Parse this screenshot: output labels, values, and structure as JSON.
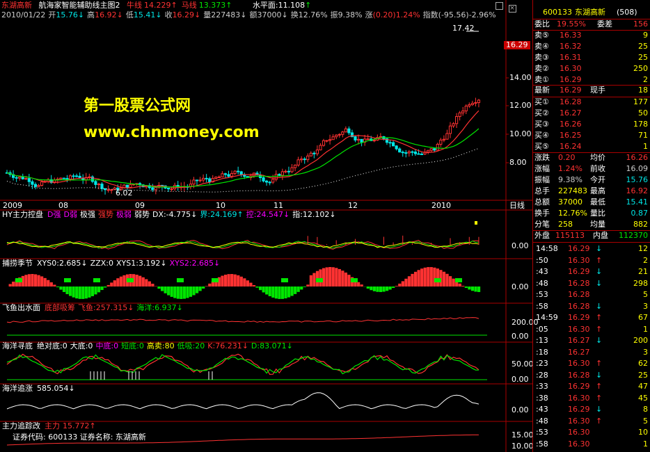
{
  "title": {
    "stock": "东湖高新",
    "formula": "航海家智能辅助线主图2",
    "lines": [
      {
        "k": "牛线",
        "v": "14.229",
        "dir": "↑"
      },
      {
        "k": "马线",
        "v": "13.373",
        "dir": "↑"
      }
    ],
    "water": "水平面:11.108",
    "water_dir": "↑"
  },
  "info_line": [
    {
      "k": "2010/01/22",
      "v": "",
      "c": "#cccccc"
    },
    {
      "k": "开",
      "v": "15.76",
      "c": "#00e6e6",
      "dir": "↓"
    },
    {
      "k": "高",
      "v": "16.92",
      "c": "#ff3232",
      "dir": "↓"
    },
    {
      "k": "低",
      "v": "15.41",
      "c": "#00e6e6",
      "dir": "↓"
    },
    {
      "k": "收",
      "v": "16.29",
      "c": "#ff3232",
      "dir": "↓"
    },
    {
      "k": "量",
      "v": "227483",
      "c": "#cccccc",
      "dir": "↓"
    },
    {
      "k": "额",
      "v": "37000",
      "c": "#cccccc",
      "dir": "↓"
    },
    {
      "k": "换",
      "v": "12.76%",
      "c": "#cccccc",
      "dir": ""
    },
    {
      "k": "振",
      "v": "9.38%",
      "c": "#cccccc",
      "dir": ""
    },
    {
      "k": "涨",
      "v": "(0.20)1.24%",
      "c": "#ff3232",
      "dir": ""
    },
    {
      "k": "指数",
      "v": "(-95.56)-2.96%",
      "c": "#cccccc",
      "dir": ""
    }
  ],
  "price_axis": [
    "14.00",
    "12.00",
    "10.00",
    "8.00"
  ],
  "current_price": "16.29",
  "peak_label": "17.42",
  "low_label": "6.02",
  "watermark": {
    "cn": "第一股票公式网",
    "url": "www.chnmoney.com"
  },
  "x_axis": [
    "2009",
    "08",
    "09",
    "10",
    "11",
    "12",
    "2010"
  ],
  "period": "日线",
  "panels": [
    {
      "id": "p1",
      "name": "HY主力控盘",
      "items": [
        {
          "t": "D强",
          "c": "#ff00ff"
        },
        {
          "t": "D弱",
          "c": "#ff00ff"
        },
        {
          "t": "极强",
          "c": "#ffffff"
        },
        {
          "t": "强势",
          "c": "#ff3232"
        },
        {
          "t": "极弱",
          "c": "#ff00ff"
        },
        {
          "t": "弱势",
          "c": "#ffffff"
        },
        {
          "t": "DX:-4.775↓",
          "c": "#ffffff"
        },
        {
          "t": "界:24.169↑",
          "c": "#00e6e6"
        },
        {
          "t": "控:24.547↓",
          "c": "#ff00ff"
        },
        {
          "t": "指:12.102↓",
          "c": "#ffffff"
        }
      ],
      "axis": "0.00"
    },
    {
      "id": "p2",
      "name": "捕捞季节",
      "items": [
        {
          "t": "XYS0:2.685↓",
          "c": "#ffffff"
        },
        {
          "t": "ZZX:0",
          "c": "#ffffff"
        },
        {
          "t": "XYS1:3.192↓",
          "c": "#ffffff"
        },
        {
          "t": "XYS2:2.685↓",
          "c": "#ff00ff"
        }
      ],
      "axis": "0.00"
    },
    {
      "id": "p3",
      "name": "飞鱼出水面",
      "items": [
        {
          "t": "底部吸筹",
          "c": "#ff3232"
        },
        {
          "t": "飞鱼:257.315↓",
          "c": "#ff3232"
        },
        {
          "t": "海洋:6.937↓",
          "c": "#00e600"
        }
      ],
      "axis": "200.00",
      "axis2": "0.00"
    },
    {
      "id": "p4",
      "name": "海洋寻底",
      "items": [
        {
          "t": "绝对底:0",
          "c": "#ffffff"
        },
        {
          "t": "大底:0",
          "c": "#ffffff"
        },
        {
          "t": "中底:0",
          "c": "#ff00ff"
        },
        {
          "t": "短底:0",
          "c": "#00e600"
        },
        {
          "t": "高卖:80",
          "c": "#ffff00"
        },
        {
          "t": "低吸:20",
          "c": "#00e600"
        },
        {
          "t": "K:76.231↓",
          "c": "#ff3232"
        },
        {
          "t": "D:83.071↓",
          "c": "#00e600"
        }
      ],
      "axis": "50.00",
      "axis2": "0.00"
    },
    {
      "id": "p5",
      "name": "海洋追涨",
      "items": [
        {
          "t": "585.054↓",
          "c": "#ffffff"
        }
      ],
      "axis": "0.00"
    },
    {
      "id": "p6",
      "name": "主力追踪改",
      "items": [
        {
          "t": "主力",
          "c": "#ff3232"
        },
        {
          "t": "15.772↑",
          "c": "#ff3232"
        }
      ],
      "line2": "证券代码: 600133 证券名称: 东湖高新",
      "axis": "15.00",
      "axis2": "10.00"
    }
  ],
  "side": {
    "code": "600133",
    "name": "东湖高新",
    "count": "(508)",
    "weibi": {
      "k": "委比",
      "v": "19.55%",
      "k2": "委差",
      "v2": "156"
    },
    "sells": [
      {
        "k": "卖⑤",
        "p": "16.33",
        "v": "9"
      },
      {
        "k": "卖④",
        "p": "16.32",
        "v": "25"
      },
      {
        "k": "卖③",
        "p": "16.31",
        "v": "25"
      },
      {
        "k": "卖②",
        "p": "16.30",
        "v": "250"
      },
      {
        "k": "卖①",
        "p": "16.29",
        "v": "2"
      }
    ],
    "latest": {
      "k": "最新",
      "p": "16.29",
      "k2": "现手",
      "v": "18"
    },
    "buys": [
      {
        "k": "买①",
        "p": "16.28",
        "v": "177"
      },
      {
        "k": "买②",
        "p": "16.27",
        "v": "50"
      },
      {
        "k": "买③",
        "p": "16.26",
        "v": "178"
      },
      {
        "k": "买④",
        "p": "16.25",
        "v": "71"
      },
      {
        "k": "买⑤",
        "p": "16.24",
        "v": "1"
      }
    ],
    "stats": [
      {
        "k": "涨跌",
        "v": "0.20",
        "c": "#ff3232",
        "k2": "均价",
        "v2": "16.26",
        "c2": "#ff3232"
      },
      {
        "k": "涨幅",
        "v": "1.24%",
        "c": "#ff3232",
        "k2": "前收",
        "v2": "16.09",
        "c2": "#cccccc"
      },
      {
        "k": "振幅",
        "v": "9.38%",
        "c": "#cccccc",
        "k2": "今开",
        "v2": "15.76",
        "c2": "#00e6e6"
      },
      {
        "k": "总手",
        "v": "227483",
        "c": "#ffff00",
        "k2": "最高",
        "v2": "16.92",
        "c2": "#ff3232"
      },
      {
        "k": "总额",
        "v": "37000",
        "c": "#ffff00",
        "k2": "最低",
        "v2": "15.41",
        "c2": "#00e6e6"
      },
      {
        "k": "换手",
        "v": "12.76%",
        "c": "#ffff00",
        "k2": "量比",
        "v2": "0.87",
        "c2": "#00e6e6"
      },
      {
        "k": "分笔",
        "v": "258",
        "c": "#ffff00",
        "k2": "均量",
        "v2": "882",
        "c2": "#ffff00"
      }
    ],
    "outer": {
      "k": "外盘",
      "v": "115113",
      "k2": "内盘",
      "v2": "112370"
    },
    "ticks": [
      {
        "t": "14:58",
        "p": "16.29",
        "d": "↓",
        "v": "12"
      },
      {
        "t": ":50",
        "p": "16.30",
        "d": "↑",
        "v": "2"
      },
      {
        "t": ":43",
        "p": "16.29",
        "d": "↓",
        "v": "21"
      },
      {
        "t": ":48",
        "p": "16.28",
        "d": "↓",
        "v": "298"
      },
      {
        "t": ":53",
        "p": "16.28",
        "d": "",
        "v": "5"
      },
      {
        "t": ":58",
        "p": "16.28",
        "d": "↓",
        "v": "3"
      },
      {
        "t": "14:59",
        "p": "16.29",
        "d": "↑",
        "v": "67"
      },
      {
        "t": ":05",
        "p": "16.30",
        "d": "↑",
        "v": "1"
      },
      {
        "t": ":13",
        "p": "16.27",
        "d": "↓",
        "v": "200"
      },
      {
        "t": ":18",
        "p": "16.27",
        "d": "",
        "v": "3"
      },
      {
        "t": ":23",
        "p": "16.30",
        "d": "↑",
        "v": "62"
      },
      {
        "t": ":28",
        "p": "16.28",
        "d": "↓",
        "v": "25"
      },
      {
        "t": ":33",
        "p": "16.29",
        "d": "↑",
        "v": "47"
      },
      {
        "t": ":38",
        "p": "16.30",
        "d": "↑",
        "v": "45"
      },
      {
        "t": ":43",
        "p": "16.29",
        "d": "↓",
        "v": "8"
      },
      {
        "t": ":48",
        "p": "16.30",
        "d": "↑",
        "v": "5"
      },
      {
        "t": ":53",
        "p": "16.30",
        "d": "",
        "v": "10"
      },
      {
        "t": ":58",
        "p": "16.30",
        "d": "",
        "v": "1"
      }
    ]
  }
}
